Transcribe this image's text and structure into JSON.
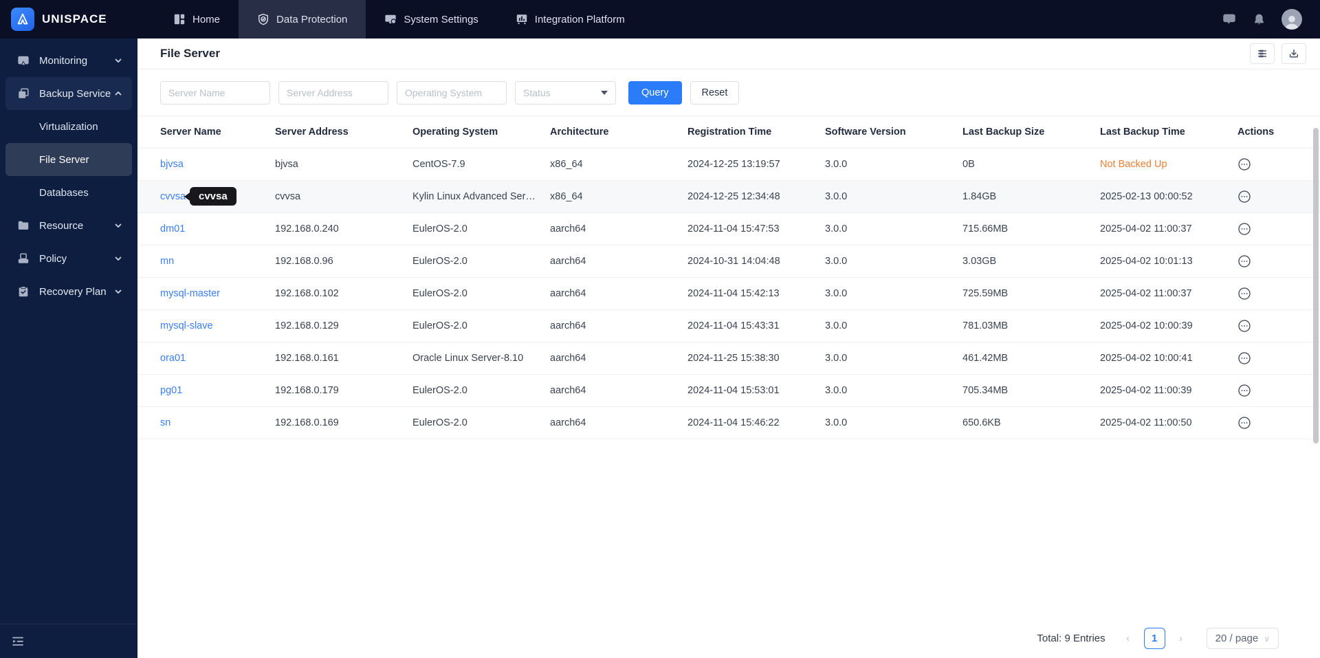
{
  "colors": {
    "topbar_bg": "#0a0f26",
    "topbar_active_tab_bg": "#272e45",
    "sidebar_bg": "#0d1e40",
    "sidebar_selected_bg": "#2f3c58",
    "accent_blue": "#2b7cf8",
    "link_blue": "#3b7df7",
    "warning_orange": "#ee7e33",
    "logo_blue": "#2f7cf6"
  },
  "topbar": {
    "brand": "UNISPACE",
    "tabs": [
      {
        "label": "Home",
        "icon": "dashboard-icon",
        "active": false
      },
      {
        "label": "Data Protection",
        "icon": "shield-check-icon",
        "active": true
      },
      {
        "label": "System Settings",
        "icon": "monitor-settings-icon",
        "active": false
      },
      {
        "label": "Integration Platform",
        "icon": "board-chart-icon",
        "active": false
      }
    ],
    "right_icons": [
      "message-icon",
      "bell-icon",
      "user-avatar"
    ]
  },
  "sidebar": {
    "items": [
      {
        "label": "Monitoring",
        "icon": "screen-cast-icon",
        "chevron": "down"
      },
      {
        "label": "Backup Service",
        "icon": "copy-icon",
        "chevron": "up",
        "expanded": true
      },
      {
        "label": "Virtualization",
        "type": "sub"
      },
      {
        "label": "File Server",
        "type": "sub",
        "selected": true
      },
      {
        "label": "Databases",
        "type": "sub"
      },
      {
        "label": "Resource",
        "icon": "folder-icon",
        "chevron": "down"
      },
      {
        "label": "Policy",
        "icon": "archive-icon",
        "chevron": "down"
      },
      {
        "label": "Recovery Plan",
        "icon": "clipboard-check-icon",
        "chevron": "down"
      }
    ]
  },
  "page": {
    "title": "File Server",
    "filters": {
      "server_name_placeholder": "Server Name",
      "server_address_placeholder": "Server Address",
      "operating_system_placeholder": "Operating System",
      "status_placeholder": "Status",
      "query_label": "Query",
      "reset_label": "Reset"
    }
  },
  "table": {
    "columns": [
      "Server Name",
      "Server Address",
      "Operating System",
      "Architecture",
      "Registration Time",
      "Software Version",
      "Last Backup Size",
      "Last Backup Time",
      "Actions"
    ],
    "rows": [
      {
        "name": "bjvsa",
        "address": "bjvsa",
        "os": "CentOS-7.9",
        "arch": "x86_64",
        "registered": "2024-12-25 13:19:57",
        "version": "3.0.0",
        "size": "0B",
        "last_backup": "Not Backed Up",
        "backup_status": "warning",
        "hovered": false
      },
      {
        "name": "cvvsa",
        "address": "cvvsa",
        "os": "Kylin Linux Advanced Ser…",
        "arch": "x86_64",
        "registered": "2024-12-25 12:34:48",
        "version": "3.0.0",
        "size": "1.84GB",
        "last_backup": "2025-02-13 00:00:52",
        "backup_status": "ok",
        "hovered": true
      },
      {
        "name": "dm01",
        "address": "192.168.0.240",
        "os": "EulerOS-2.0",
        "arch": "aarch64",
        "registered": "2024-11-04 15:47:53",
        "version": "3.0.0",
        "size": "715.66MB",
        "last_backup": "2025-04-02 11:00:37",
        "backup_status": "ok",
        "hovered": false
      },
      {
        "name": "mn",
        "address": "192.168.0.96",
        "os": "EulerOS-2.0",
        "arch": "aarch64",
        "registered": "2024-10-31 14:04:48",
        "version": "3.0.0",
        "size": "3.03GB",
        "last_backup": "2025-04-02 10:01:13",
        "backup_status": "ok",
        "hovered": false
      },
      {
        "name": "mysql-master",
        "address": "192.168.0.102",
        "os": "EulerOS-2.0",
        "arch": "aarch64",
        "registered": "2024-11-04 15:42:13",
        "version": "3.0.0",
        "size": "725.59MB",
        "last_backup": "2025-04-02 11:00:37",
        "backup_status": "ok",
        "hovered": false
      },
      {
        "name": "mysql-slave",
        "address": "192.168.0.129",
        "os": "EulerOS-2.0",
        "arch": "aarch64",
        "registered": "2024-11-04 15:43:31",
        "version": "3.0.0",
        "size": "781.03MB",
        "last_backup": "2025-04-02 10:00:39",
        "backup_status": "ok",
        "hovered": false
      },
      {
        "name": "ora01",
        "address": "192.168.0.161",
        "os": "Oracle Linux Server-8.10",
        "arch": "aarch64",
        "registered": "2024-11-25 15:38:30",
        "version": "3.0.0",
        "size": "461.42MB",
        "last_backup": "2025-04-02 10:00:41",
        "backup_status": "ok",
        "hovered": false
      },
      {
        "name": "pg01",
        "address": "192.168.0.179",
        "os": "EulerOS-2.0",
        "arch": "aarch64",
        "registered": "2024-11-04 15:53:01",
        "version": "3.0.0",
        "size": "705.34MB",
        "last_backup": "2025-04-02 11:00:39",
        "backup_status": "ok",
        "hovered": false
      },
      {
        "name": "sn",
        "address": "192.168.0.169",
        "os": "EulerOS-2.0",
        "arch": "aarch64",
        "registered": "2024-11-04 15:46:22",
        "version": "3.0.0",
        "size": "650.6KB",
        "last_backup": "2025-04-02 11:00:50",
        "backup_status": "ok",
        "hovered": false
      }
    ]
  },
  "tooltip": {
    "text": "cvvsa"
  },
  "pagination": {
    "total_text": "Total: 9 Entries",
    "prev_label": "‹",
    "next_label": "›",
    "current_page": "1",
    "page_size": "20 / page",
    "size_caret": "∨"
  }
}
